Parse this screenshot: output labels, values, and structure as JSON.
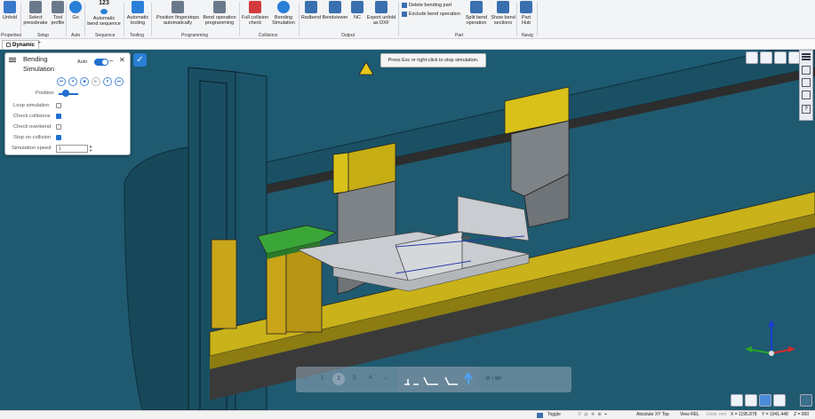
{
  "ribbon": {
    "buttons": [
      {
        "key": "unfold",
        "label": "Unfold",
        "color": "#3a78c9"
      },
      {
        "key": "select_pressbrake",
        "label": "Select pressbrake",
        "color": "#6a7a8c"
      },
      {
        "key": "tool_profile",
        "label": "Tool profile",
        "color": "#6a7a8c"
      },
      {
        "key": "go",
        "label": "Go",
        "color": "#2a7fd6"
      },
      {
        "key": "auto_bend_seq",
        "label": "Automatic bend sequence",
        "color": "#2a7fd6"
      },
      {
        "key": "auto_tooling",
        "label": "Automatic tooling",
        "color": "#2a7fd6"
      },
      {
        "key": "pos_fingerstops",
        "label": "Position fingerstops automatically",
        "color": "#6a7a8c"
      },
      {
        "key": "bend_op_prog",
        "label": "Bend operation programming",
        "color": "#6a7a8c"
      },
      {
        "key": "full_collision",
        "label": "Full collision check",
        "color": "#d23b3b"
      },
      {
        "key": "bending_sim",
        "label": "Bending Simulation",
        "color": "#2a7fd6"
      },
      {
        "key": "radbend",
        "label": "Radbend",
        "color": "#3a6fb0"
      },
      {
        "key": "bendviewer",
        "label": "Bendviewer",
        "color": "#3a6fb0"
      },
      {
        "key": "nc",
        "label": "NC",
        "color": "#3a6fb0"
      },
      {
        "key": "export_dxf",
        "label": "Export unfold as DXF",
        "color": "#3a6fb0"
      },
      {
        "key": "split_bend",
        "label": "Split bend operation",
        "color": "#3a6fb0"
      },
      {
        "key": "show_sections",
        "label": "Show bend sections",
        "color": "#3a6fb0"
      },
      {
        "key": "part_hub",
        "label": "Part Hub",
        "color": "#3a6fb0"
      }
    ],
    "small_buttons": {
      "delete_bending": "Delete bending part",
      "exclude_bend": "Exclude bend operation"
    },
    "go_number": "123",
    "groups": [
      "Properties",
      "Setup",
      "Auto",
      "Sequence",
      "Tooling",
      "Programming",
      "Collisions",
      "Output",
      "Part",
      "Navig"
    ]
  },
  "tabs": {
    "dynamic": "Dynamic",
    "add": "+"
  },
  "panel": {
    "title": "Bending Simulation",
    "auto_label": "Auto",
    "position_label": "Position",
    "loop_label": "Loop simulation",
    "check_collisions_label": "Check collisions",
    "check_overbend_label": "Check overbend",
    "stop_on_collision_label": "Stop on collision",
    "speed_label": "Simulation speed",
    "speed_value": "1",
    "loop": false,
    "check_collisions": true,
    "check_overbend": false,
    "stop_on_collision": true
  },
  "tooltip": "Press Esc or right-click to stop simulation.",
  "bottom_bar": {
    "pages": [
      "1",
      "2",
      "3",
      "4"
    ],
    "current": "2",
    "angle": "0° / 90°"
  },
  "status": {
    "toggle": "Toggle",
    "mode": "Absolute XY Top",
    "view": "View REL",
    "units": "Units: mm",
    "x": "X = 1195.878",
    "y": "Y = 1041.448",
    "z": "Z = 000"
  },
  "colors": {
    "viewport": "#1f5a70",
    "accent": "#2a7fd6",
    "tool_yellow": "#d9c11a",
    "sheet": "#c9ccd0"
  }
}
